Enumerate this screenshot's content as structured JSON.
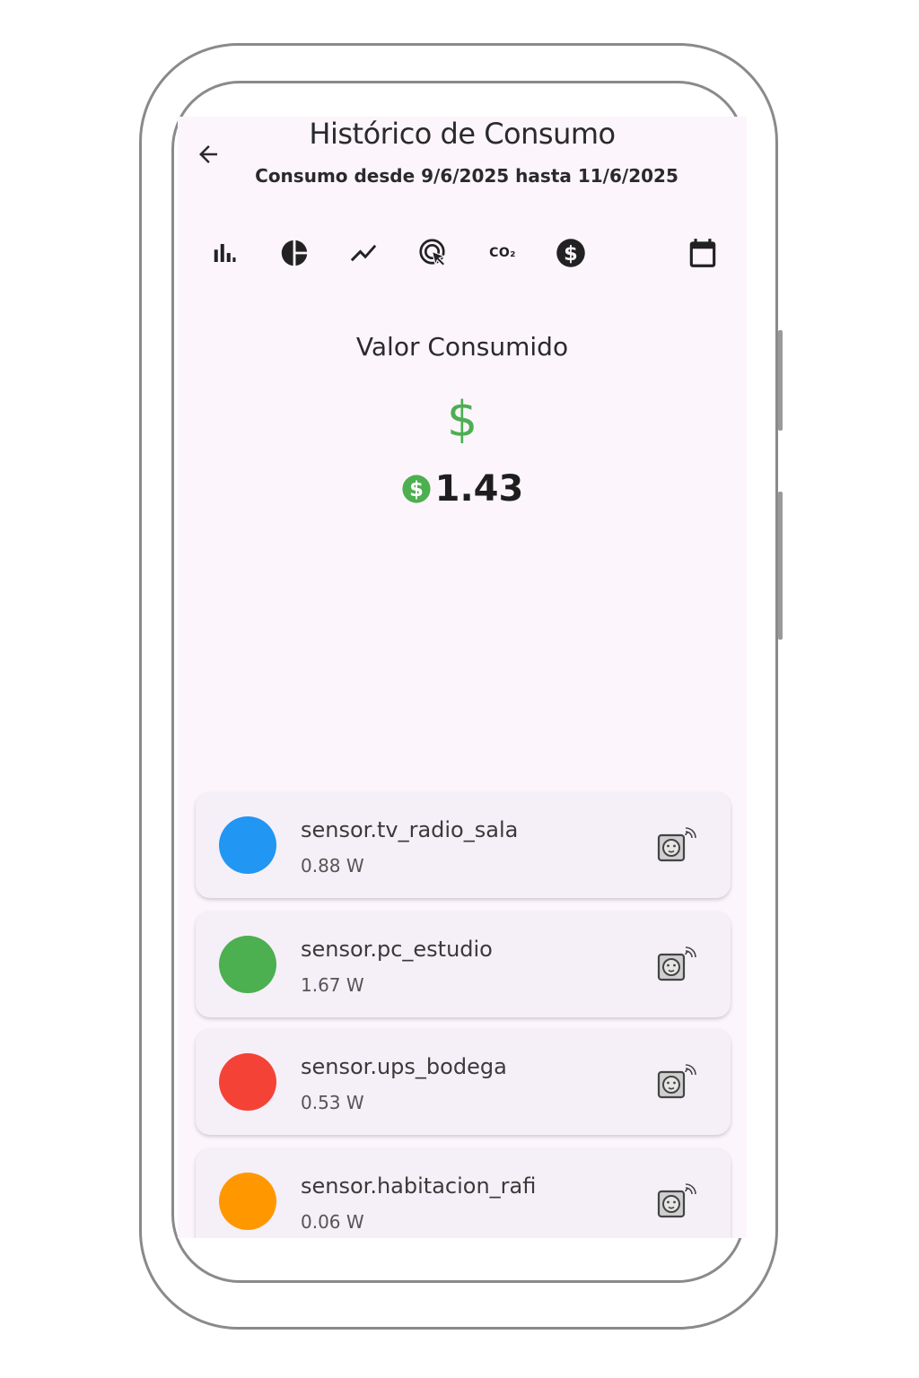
{
  "header": {
    "title": "Histórico de Consumo",
    "subtitle": "Consumo desde 9/6/2025 hasta 11/6/2025"
  },
  "toolbar": {
    "icons": [
      "bar-chart-icon",
      "pie-chart-icon",
      "trend-line-icon",
      "touch-click-icon",
      "co2-icon",
      "dollar-icon",
      "calendar-icon"
    ],
    "co2_label": "CO₂"
  },
  "summary": {
    "title": "Valor Consumido",
    "currency_symbol": "$",
    "value": "1.43",
    "accent_color": "#4caf50"
  },
  "devices": [
    {
      "name": "sensor.tv_radio_sala",
      "power": "0.88 W",
      "color": "#2196f3"
    },
    {
      "name": "sensor.pc_estudio",
      "power": "1.67 W",
      "color": "#4caf50"
    },
    {
      "name": "sensor.ups_bodega",
      "power": "0.53 W",
      "color": "#f44336"
    },
    {
      "name": "sensor.habitacion_rafi",
      "power": "0.06 W",
      "color": "#ff9800"
    }
  ]
}
